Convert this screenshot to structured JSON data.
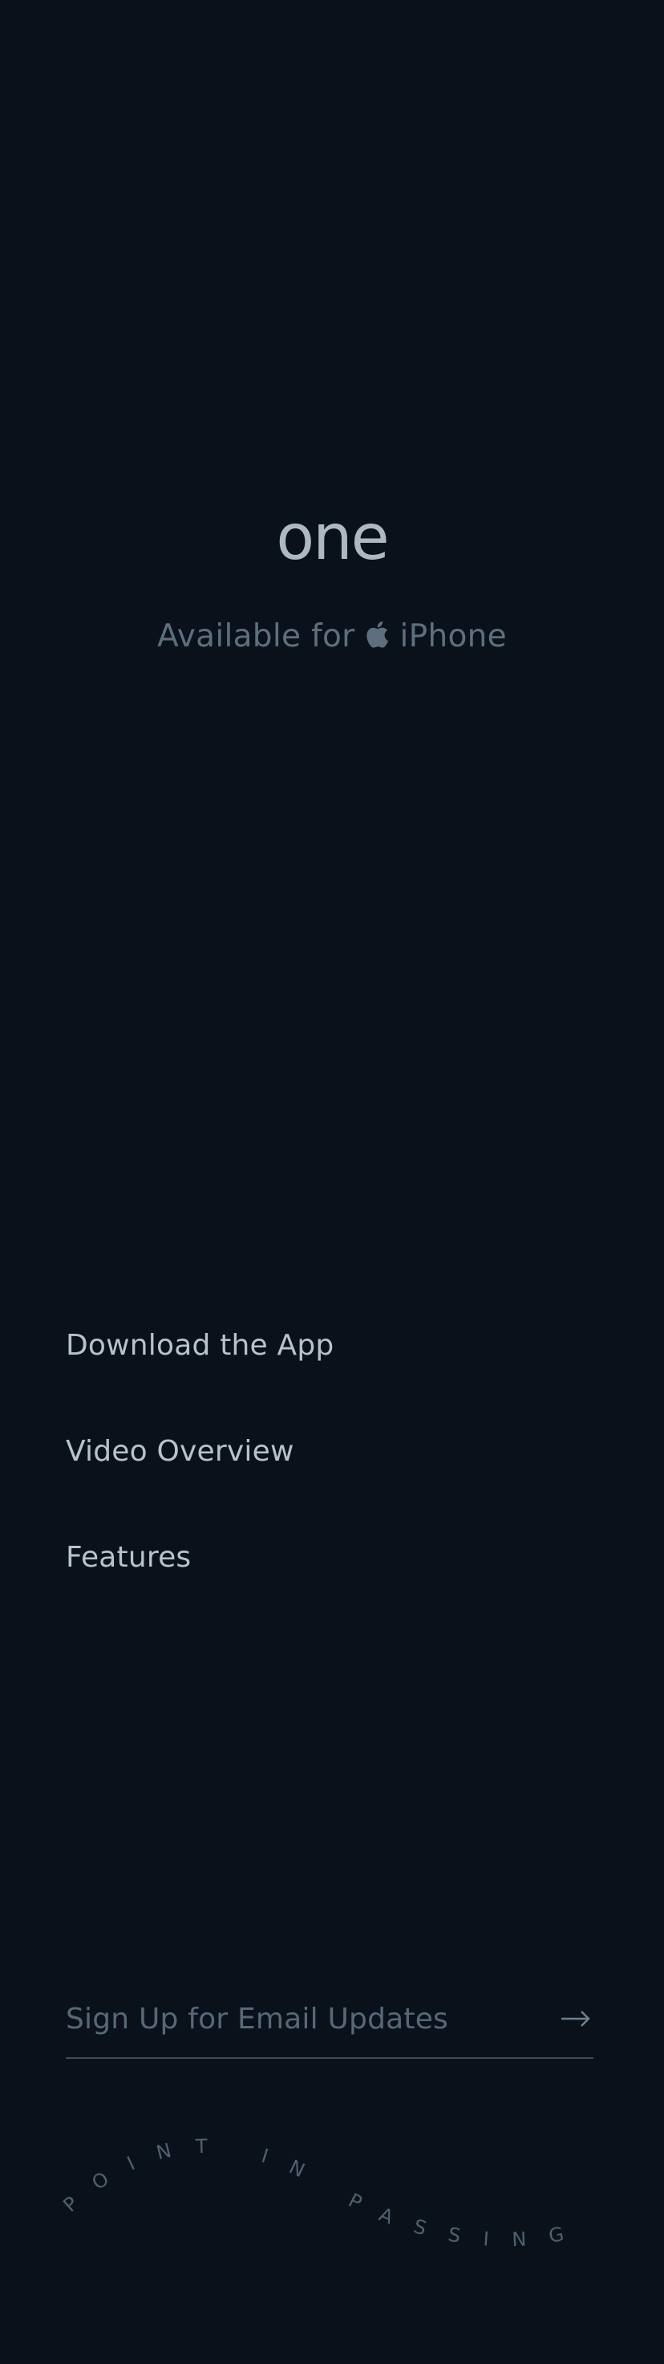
{
  "app": {
    "logo_text": "one",
    "availability": {
      "prefix": "Available for",
      "platform_icon": "apple-icon",
      "platform": "iPhone"
    }
  },
  "nav": {
    "items": [
      {
        "label": "Download the App"
      },
      {
        "label": "Video Overview"
      },
      {
        "label": "Features"
      }
    ]
  },
  "signup": {
    "placeholder": "Sign Up for Email Updates",
    "value": "",
    "submit_icon": "arrow-right-icon"
  },
  "tagline": {
    "text": "POINT IN PASSING"
  },
  "colors": {
    "background": "#0b111a",
    "logo": "#aeb8c1",
    "muted": "#5d6f7e",
    "nav_text": "#b8c2cc",
    "tagline": "#4f6070"
  }
}
